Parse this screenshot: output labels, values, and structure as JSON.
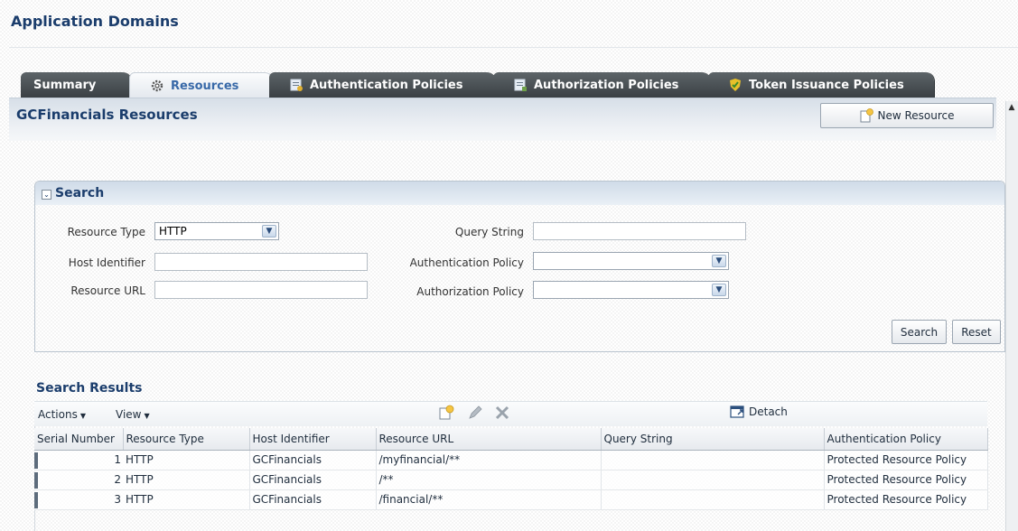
{
  "page": {
    "title": "Application Domains"
  },
  "tabs": [
    {
      "label": "Summary",
      "icon": "none",
      "active": false
    },
    {
      "label": "Resources",
      "icon": "gear-icon",
      "active": true
    },
    {
      "label": "Authentication Policies",
      "icon": "authentication-policy-icon",
      "active": false
    },
    {
      "label": "Authorization Policies",
      "icon": "authorization-policy-icon",
      "active": false
    },
    {
      "label": "Token Issuance Policies",
      "icon": "token-shield-icon",
      "active": false
    }
  ],
  "content": {
    "title": "GCFinancials Resources",
    "new_resource_label": "New Resource"
  },
  "search": {
    "title": "Search",
    "resource_type_label": "Resource Type",
    "resource_type_value": "HTTP",
    "host_identifier_label": "Host Identifier",
    "host_identifier_value": "",
    "resource_url_label": "Resource URL",
    "resource_url_value": "",
    "query_string_label": "Query String",
    "query_string_value": "",
    "authentication_policy_label": "Authentication Policy",
    "authentication_policy_value": "",
    "authorization_policy_label": "Authorization Policy",
    "authorization_policy_value": "",
    "search_button": "Search",
    "reset_button": "Reset"
  },
  "results": {
    "title": "Search Results",
    "actions_label": "Actions",
    "view_label": "View",
    "detach_label": "Detach",
    "columns": [
      "Serial Number",
      "Resource Type",
      "Host Identifier",
      "Resource URL",
      "Query String",
      "Authentication Policy"
    ],
    "rows": [
      {
        "serial": "1",
        "type": "HTTP",
        "host": "GCFinancials",
        "url": "/myfinancial/**",
        "query": "",
        "auth_policy": "Protected Resource Policy"
      },
      {
        "serial": "2",
        "type": "HTTP",
        "host": "GCFinancials",
        "url": "/**",
        "query": "",
        "auth_policy": "Protected Resource Policy"
      },
      {
        "serial": "3",
        "type": "HTTP",
        "host": "GCFinancials",
        "url": "/financial/**",
        "query": "",
        "auth_policy": "Protected Resource Policy"
      }
    ]
  },
  "colors": {
    "title_blue": "#1b3d6c",
    "tab_dark": "#4a5155",
    "tab_active_text": "#3869a8"
  }
}
